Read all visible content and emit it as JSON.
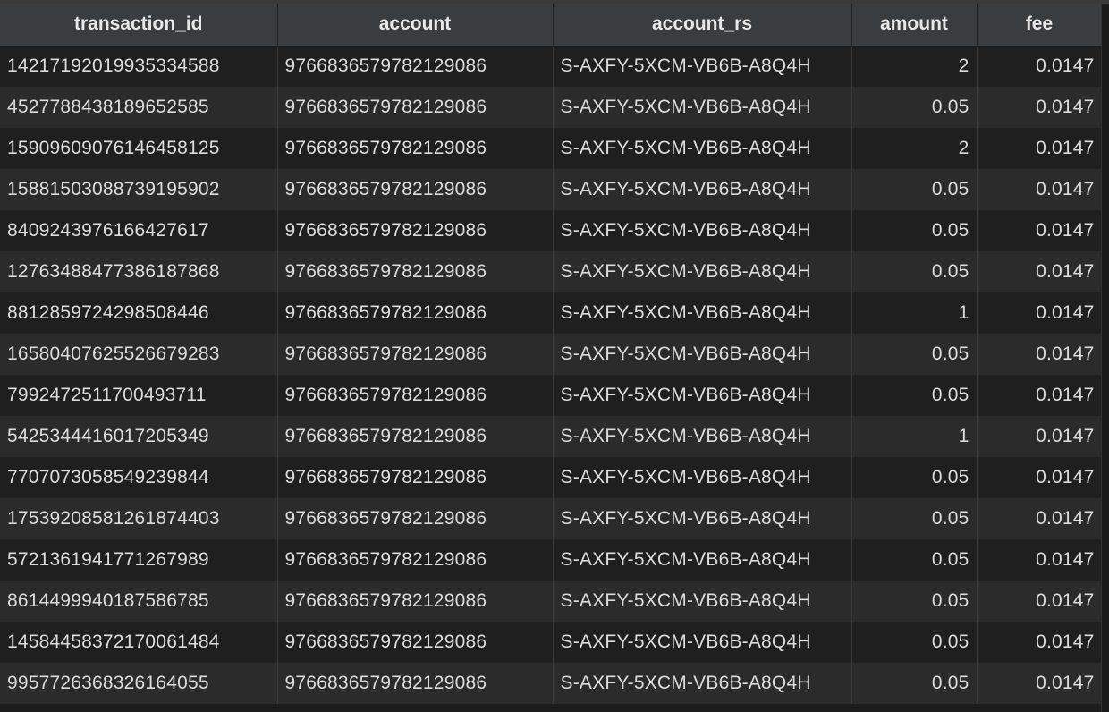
{
  "columns": [
    {
      "key": "transaction_id",
      "label": "transaction_id",
      "align": "left"
    },
    {
      "key": "account",
      "label": "account",
      "align": "left"
    },
    {
      "key": "account_rs",
      "label": "account_rs",
      "align": "left"
    },
    {
      "key": "amount",
      "label": "amount",
      "align": "right"
    },
    {
      "key": "fee",
      "label": "fee",
      "align": "right"
    }
  ],
  "rows": [
    [
      "14217192019935334588",
      "9766836579782129086",
      "S-AXFY-5XCM-VB6B-A8Q4H",
      "2",
      "0.0147"
    ],
    [
      "4527788438189652585",
      "9766836579782129086",
      "S-AXFY-5XCM-VB6B-A8Q4H",
      "0.05",
      "0.0147"
    ],
    [
      "15909609076146458125",
      "9766836579782129086",
      "S-AXFY-5XCM-VB6B-A8Q4H",
      "2",
      "0.0147"
    ],
    [
      "15881503088739195902",
      "9766836579782129086",
      "S-AXFY-5XCM-VB6B-A8Q4H",
      "0.05",
      "0.0147"
    ],
    [
      "8409243976166427617",
      "9766836579782129086",
      "S-AXFY-5XCM-VB6B-A8Q4H",
      "0.05",
      "0.0147"
    ],
    [
      "12763488477386187868",
      "9766836579782129086",
      "S-AXFY-5XCM-VB6B-A8Q4H",
      "0.05",
      "0.0147"
    ],
    [
      "8812859724298508446",
      "9766836579782129086",
      "S-AXFY-5XCM-VB6B-A8Q4H",
      "1",
      "0.0147"
    ],
    [
      "16580407625526679283",
      "9766836579782129086",
      "S-AXFY-5XCM-VB6B-A8Q4H",
      "0.05",
      "0.0147"
    ],
    [
      "7992472511700493711",
      "9766836579782129086",
      "S-AXFY-5XCM-VB6B-A8Q4H",
      "0.05",
      "0.0147"
    ],
    [
      "5425344416017205349",
      "9766836579782129086",
      "S-AXFY-5XCM-VB6B-A8Q4H",
      "1",
      "0.0147"
    ],
    [
      "7707073058549239844",
      "9766836579782129086",
      "S-AXFY-5XCM-VB6B-A8Q4H",
      "0.05",
      "0.0147"
    ],
    [
      "17539208581261874403",
      "9766836579782129086",
      "S-AXFY-5XCM-VB6B-A8Q4H",
      "0.05",
      "0.0147"
    ],
    [
      "5721361941771267989",
      "9766836579782129086",
      "S-AXFY-5XCM-VB6B-A8Q4H",
      "0.05",
      "0.0147"
    ],
    [
      "8614499940187586785",
      "9766836579782129086",
      "S-AXFY-5XCM-VB6B-A8Q4H",
      "0.05",
      "0.0147"
    ],
    [
      "14584458372170061484",
      "9766836579782129086",
      "S-AXFY-5XCM-VB6B-A8Q4H",
      "0.05",
      "0.0147"
    ],
    [
      "9957726368326164055",
      "9766836579782129086",
      "S-AXFY-5XCM-VB6B-A8Q4H",
      "0.05",
      "0.0147"
    ]
  ],
  "colors": {
    "header_bg": "#3a3d3f",
    "row_odd": "#1f1f1f",
    "row_even": "#2b2b2b",
    "text": "#dcdcdc"
  }
}
